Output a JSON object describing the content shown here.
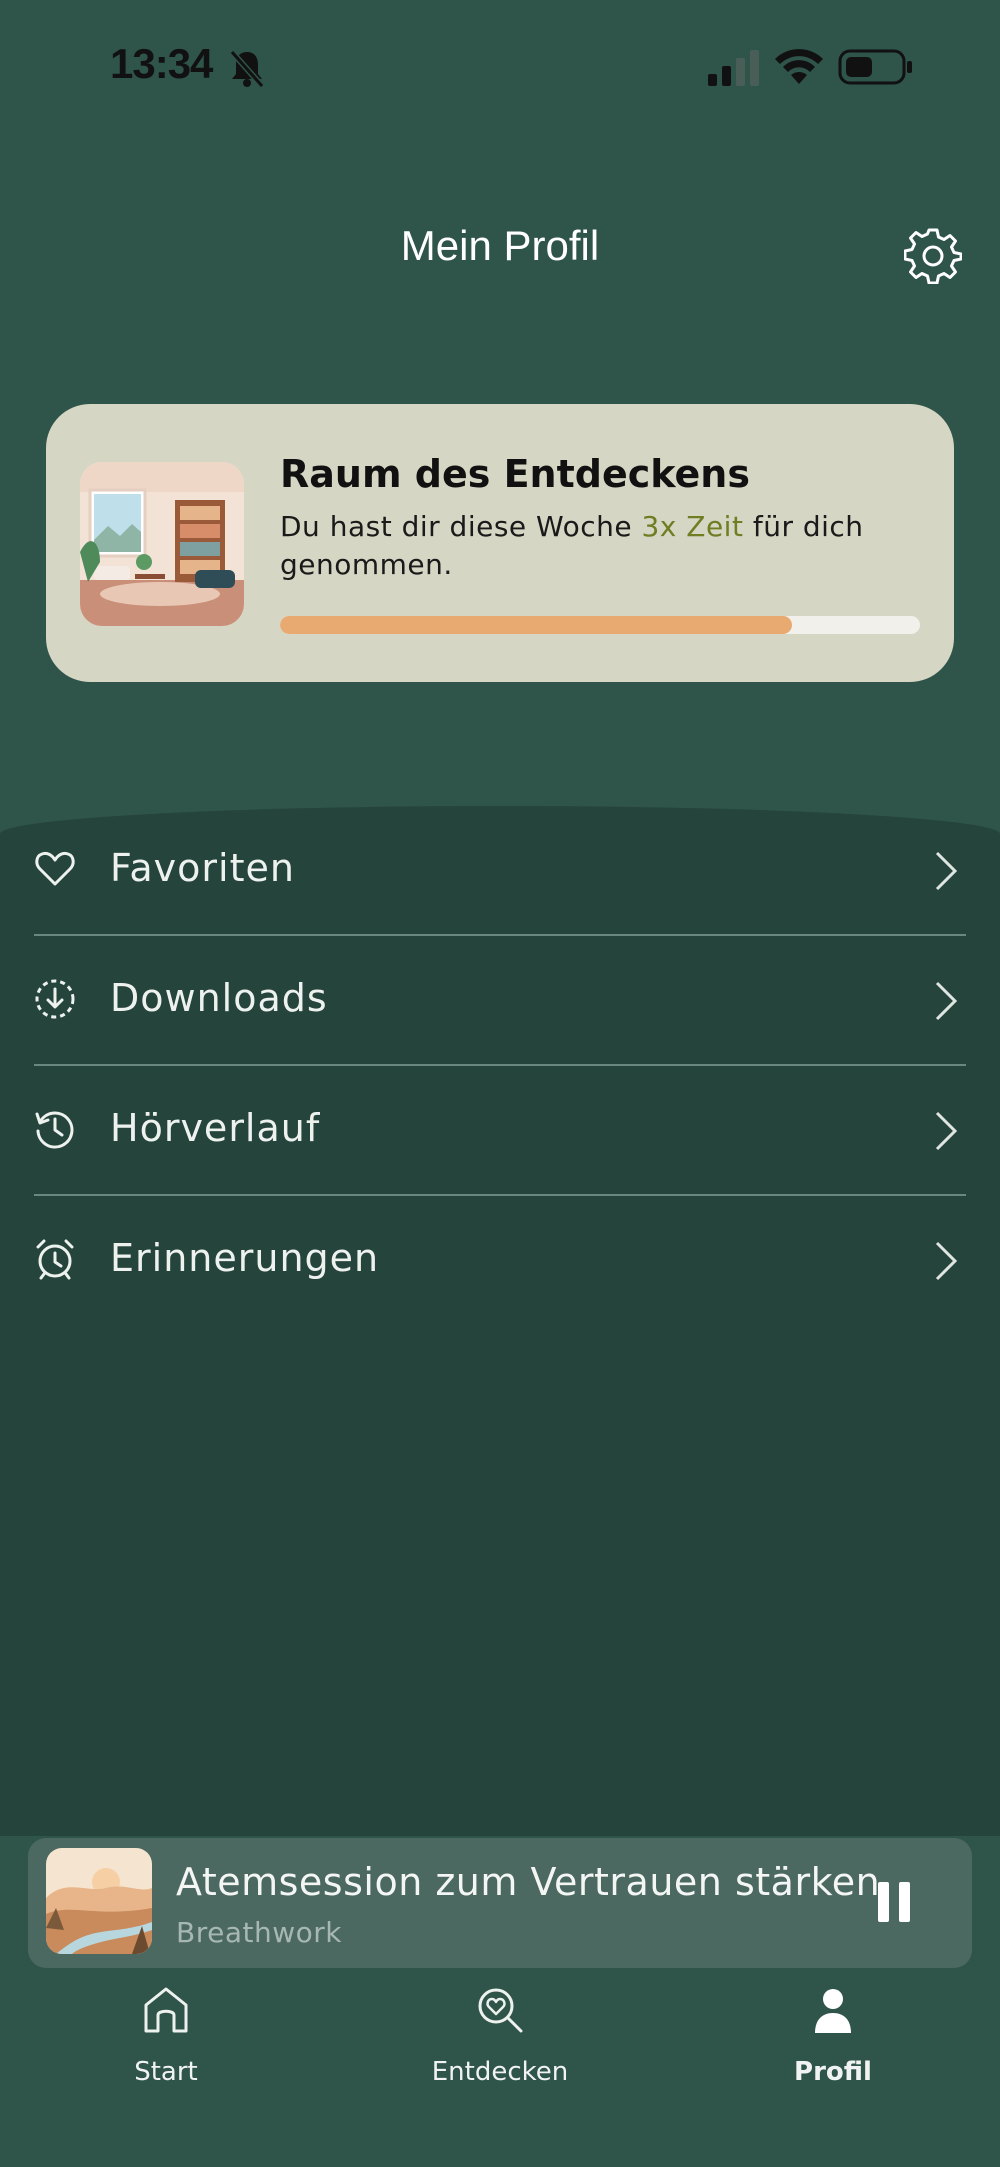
{
  "status_bar": {
    "time": "13:34"
  },
  "header": {
    "title": "Mein Profil"
  },
  "progress_card": {
    "title": "Raum des Entdeckens",
    "text_before": "Du hast dir diese Woche ",
    "highlight": "3x Zeit",
    "text_after": " für dich genommen.",
    "progress": 0.8,
    "colors": {
      "card": "#d6d6c4",
      "bar": "#e9aa72",
      "highlight": "#6f7d23"
    }
  },
  "menu": {
    "items": [
      {
        "label": "Favoriten",
        "icon": "heart-icon"
      },
      {
        "label": "Downloads",
        "icon": "download-icon"
      },
      {
        "label": "Hörverlauf",
        "icon": "history-icon"
      },
      {
        "label": "Erinnerungen",
        "icon": "alarm-icon"
      }
    ]
  },
  "player": {
    "title": "Atemsession zum Vertrauen stärken",
    "subtitle": "Breathwork"
  },
  "tabs": [
    {
      "label": "Start",
      "icon": "home-icon"
    },
    {
      "label": "Entdecken",
      "icon": "discover-icon"
    },
    {
      "label": "Profil",
      "icon": "profile-icon",
      "active": true
    }
  ]
}
